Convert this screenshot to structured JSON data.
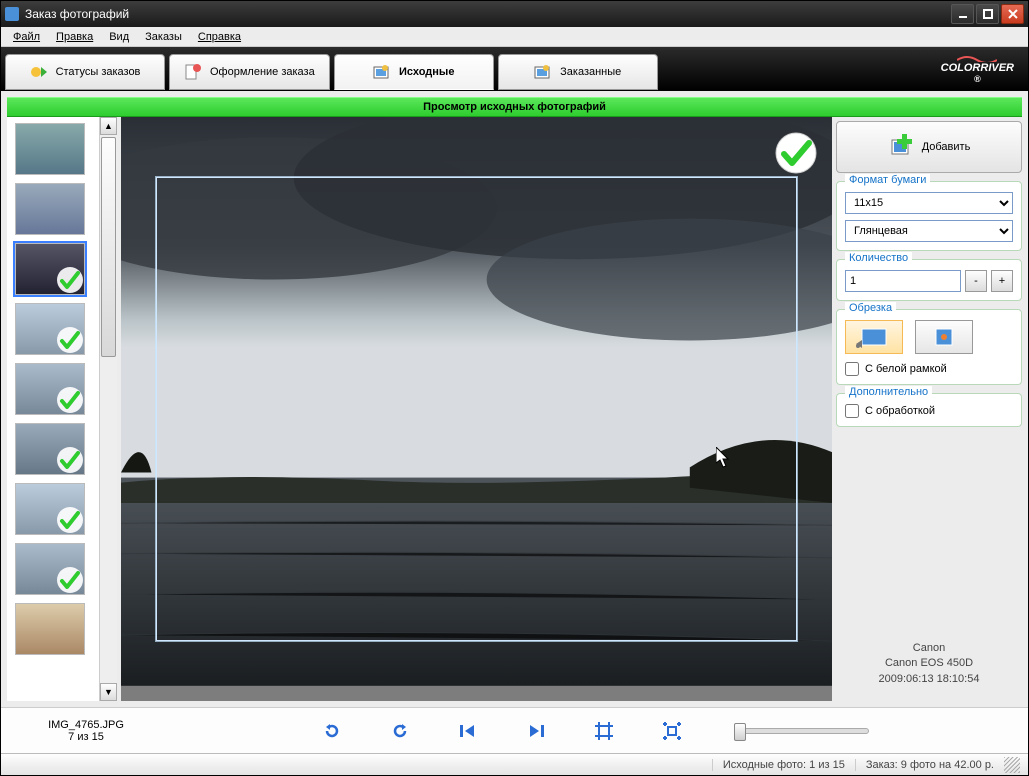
{
  "window": {
    "title": "Заказ фотографий"
  },
  "menu": [
    "Файл",
    "Правка",
    "Вид",
    "Заказы",
    "Справка"
  ],
  "tabs": [
    {
      "label": "Статусы заказов"
    },
    {
      "label": "Оформление заказа"
    },
    {
      "label": "Исходные",
      "active": true
    },
    {
      "label": "Заказанные"
    }
  ],
  "brand": "COLORRIVER",
  "header": "Просмотр исходных фотографий",
  "thumbs": [
    {
      "checked": false
    },
    {
      "checked": false
    },
    {
      "checked": true,
      "selected": true
    },
    {
      "checked": true
    },
    {
      "checked": true
    },
    {
      "checked": true
    },
    {
      "checked": true
    },
    {
      "checked": true
    },
    {
      "checked": false
    }
  ],
  "sidebar": {
    "add_label": "Добавить",
    "paper": {
      "legend": "Формат бумаги",
      "size_value": "11x15",
      "finish_value": "Глянцевая"
    },
    "qty": {
      "legend": "Количество",
      "value": "1"
    },
    "crop": {
      "legend": "Обрезка",
      "white_border_label": "С белой рамкой"
    },
    "extra": {
      "legend": "Дополнительно",
      "processing_label": "С обработкой"
    }
  },
  "meta": {
    "make": "Canon",
    "model": "Canon EOS 450D",
    "datetime": "2009:06:13 18:10:54"
  },
  "footer": {
    "filename": "IMG_4765.JPG",
    "position": "7 из 15"
  },
  "status": {
    "source": "Исходные фото:  1 из 15",
    "order": "Заказ: 9 фото на 42.00 р."
  }
}
